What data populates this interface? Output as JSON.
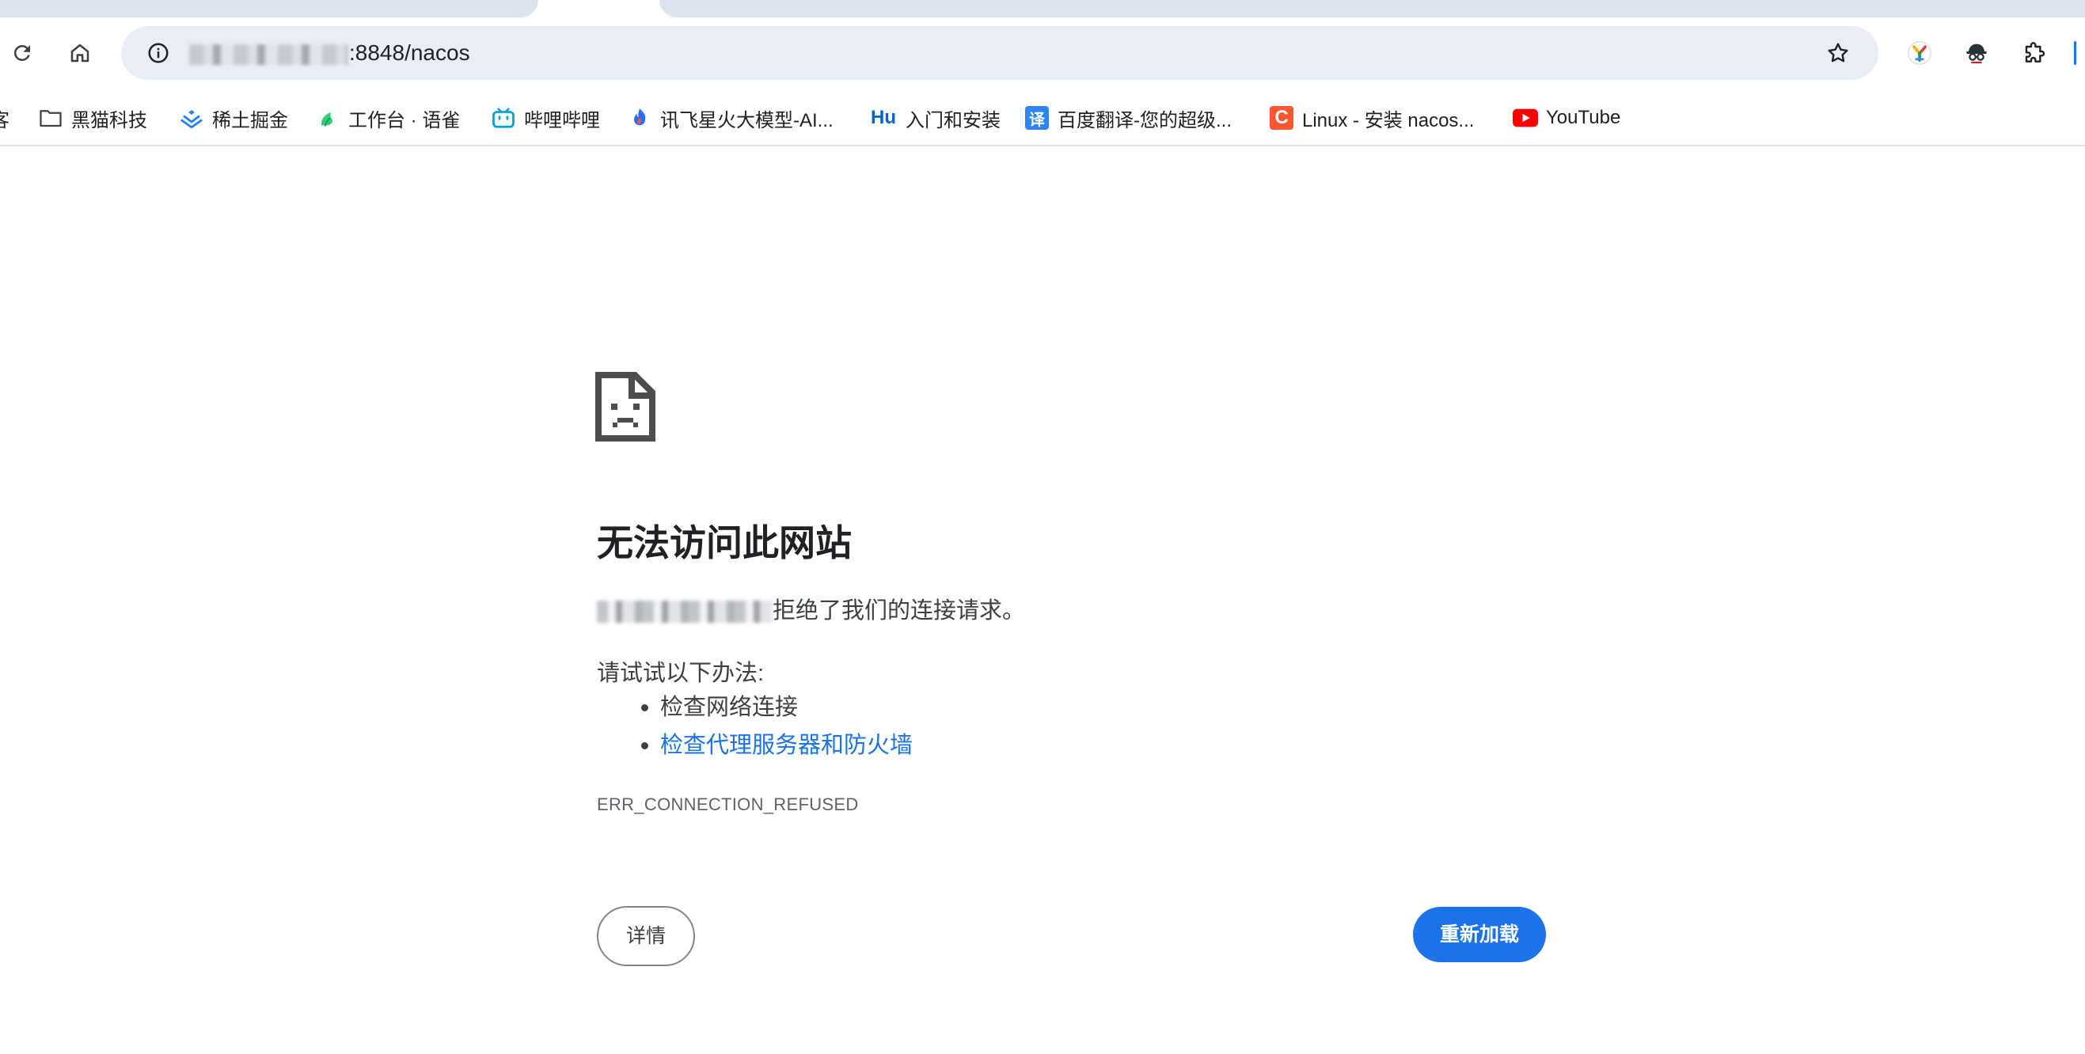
{
  "browser": {
    "address_bar": {
      "url_visible": ":8848/nacos"
    },
    "bookmarks": [
      {
        "label": "客",
        "icon": "partial-bookmark-icon"
      },
      {
        "label": "黑猫科技",
        "icon": "folder-icon"
      },
      {
        "label": "稀土掘金",
        "icon": "juejin-icon"
      },
      {
        "label": "工作台 · 语雀",
        "icon": "yuque-icon"
      },
      {
        "label": "哔哩哔哩",
        "icon": "bilibili-icon"
      },
      {
        "label": "讯飞星火大模型-AI...",
        "icon": "xinghuo-icon"
      },
      {
        "label": "入门和安装",
        "icon": "hu-icon",
        "icon_text": "Hu"
      },
      {
        "label": "百度翻译-您的超级...",
        "icon": "baidu-translate-icon",
        "icon_text": "译"
      },
      {
        "label": "Linux - 安装 nacos...",
        "icon": "csdn-icon",
        "icon_text": "C"
      },
      {
        "label": "YouTube",
        "icon": "youtube-icon"
      }
    ]
  },
  "error_page": {
    "title": "无法访问此网站",
    "host_message": "拒绝了我们的连接请求。",
    "try_label": "请试试以下办法:",
    "suggestions": [
      "检查网络连接",
      "检查代理服务器和防火墙"
    ],
    "error_code": "ERR_CONNECTION_REFUSED",
    "details_button": "详情",
    "reload_button": "重新加载"
  },
  "colors": {
    "accent": "#1a73e8",
    "tab_strip": "#dde3ef",
    "omnibox": "#e9edf6",
    "youtube_red": "#ff0000",
    "csdn_orange": "#fc5531",
    "baidu_blue": "#2d86ef",
    "hu_blue": "#0066cc"
  }
}
